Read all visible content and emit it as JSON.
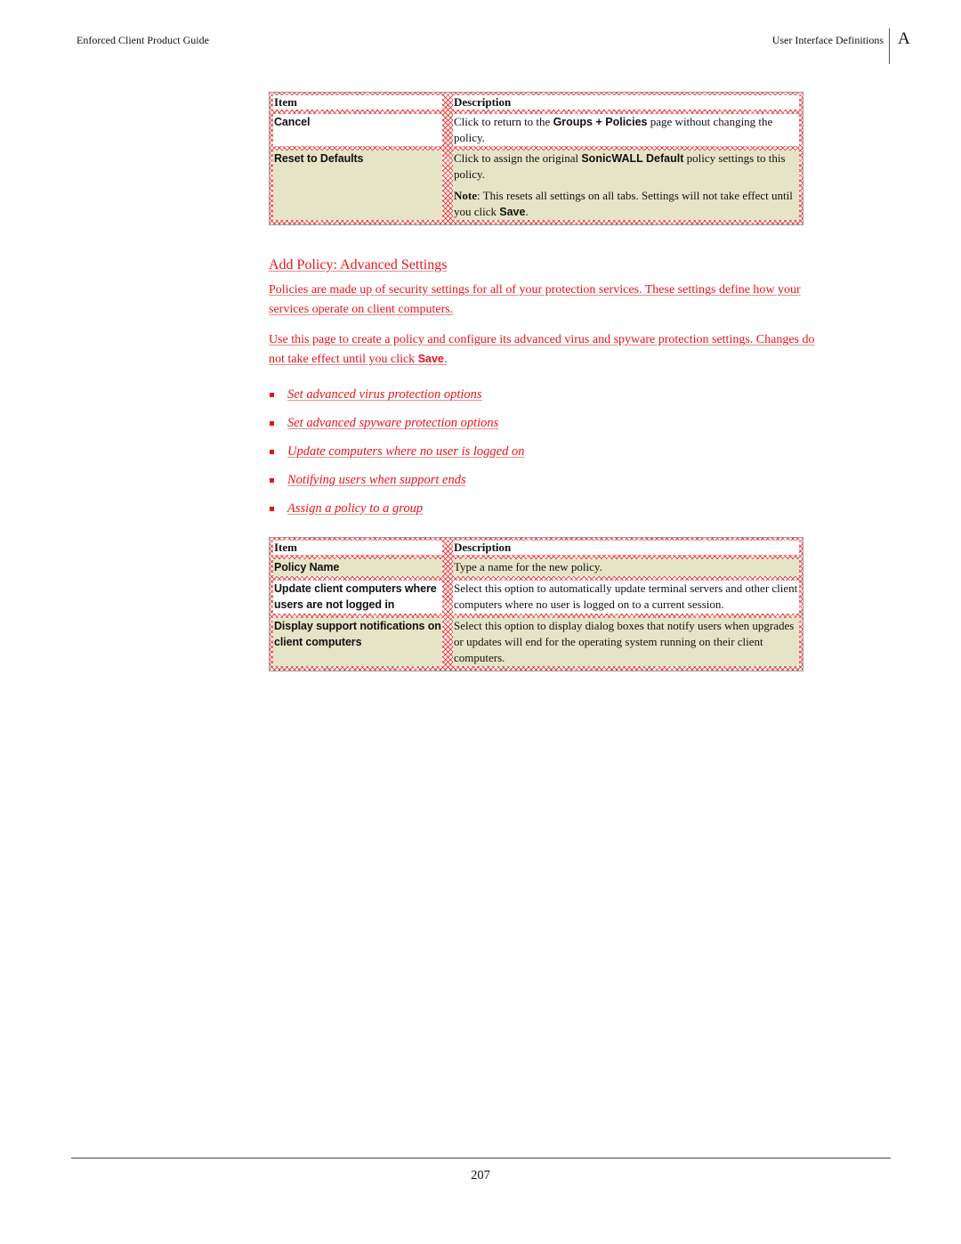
{
  "header": {
    "left_title": "Enforced Client Product Guide",
    "right_title": "User Interface Definitions",
    "appendix_letter": "A"
  },
  "table1": {
    "headers": {
      "item": "Item",
      "description": "Description"
    },
    "rows": [
      {
        "item": "Cancel",
        "fill": "white",
        "description": [
          {
            "segments": [
              {
                "text": "Click to return to the ",
                "bold_sans": false
              },
              {
                "text": "Groups + Policies",
                "bold_sans": true
              },
              {
                "text": " page without changing the policy.",
                "bold_sans": false
              }
            ]
          }
        ]
      },
      {
        "item": "Reset to Defaults",
        "fill": "tan",
        "description": [
          {
            "segments": [
              {
                "text": "Click to assign the original ",
                "bold_sans": false
              },
              {
                "text": "SonicWALL Default",
                "bold_sans": true
              },
              {
                "text": " policy settings to this policy.",
                "bold_sans": false
              }
            ]
          },
          {
            "segments": [
              {
                "text": "Note",
                "bold_serif": true
              },
              {
                "text": ": This resets all settings on all tabs. Settings will not take effect until you click ",
                "bold_sans": false
              },
              {
                "text": "Save",
                "bold_sans": true
              },
              {
                "text": ".",
                "bold_sans": false
              }
            ]
          }
        ]
      }
    ]
  },
  "section": {
    "title": "Add Policy: Advanced Settings",
    "para1": "Policies are made up of security settings for all of your protection services. These settings define how your services operate on client computers.",
    "para2_before": "Use this page to create a policy and configure its advanced virus and spyware protection settings. Changes do not take effect until you click ",
    "para2_save": "Save",
    "para2_after": ".",
    "links": [
      "Set advanced virus protection options",
      "Set advanced spyware protection options",
      "Update computers where no user is logged on",
      "Notifying users when support ends",
      "Assign a policy to a group"
    ]
  },
  "table2": {
    "headers": {
      "item": "Item",
      "description": "Description"
    },
    "rows": [
      {
        "item": "Policy Name",
        "fill": "tan",
        "description": "Type a name for the new policy."
      },
      {
        "item": "Update client computers where users are not logged in",
        "fill": "white",
        "description": "Select this option to automatically update terminal servers and other client computers where no user is logged on to a current session."
      },
      {
        "item": "Display support notifications on client computers",
        "fill": "tan",
        "description": "Select this option to display dialog boxes that notify users when upgrades or updates will end for the operating system running on their client computers."
      }
    ]
  },
  "colors": {
    "link_red": "#e8141c",
    "row_tan": "#e6e4c6",
    "hatch_red": "#eb2828"
  },
  "footer": {
    "page_number": "207"
  }
}
